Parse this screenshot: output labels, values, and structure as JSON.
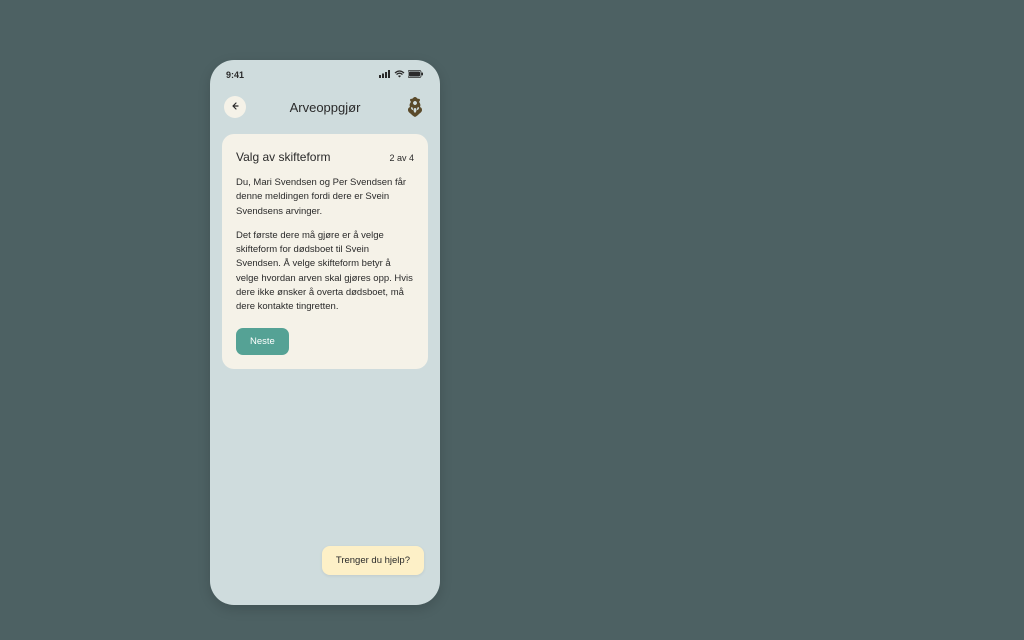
{
  "status_bar": {
    "time": "9:41"
  },
  "header": {
    "title": "Arveoppgjør"
  },
  "card": {
    "title": "Valg av skifteform",
    "step": "2 av 4",
    "paragraph1": "Du, Mari Svendsen og Per Svendsen får denne meldingen fordi dere er Svein Svendsens arvinger.",
    "paragraph2": "Det første dere må gjøre er å velge skifteform for dødsboet til Svein Svendsen. Å velge skifteform betyr å velge hvordan arven skal gjøres opp. Hvis dere ikke ønsker å overta dødsboet, må dere kontakte tingretten.",
    "next_label": "Neste"
  },
  "help": {
    "label": "Trenger du hjelp?"
  }
}
